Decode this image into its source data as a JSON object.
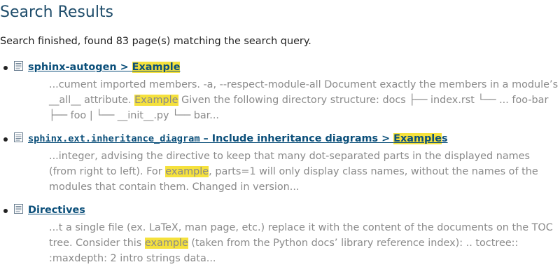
{
  "page": {
    "title": "Search Results",
    "status": "Search finished, found 83 page(s) matching the search query."
  },
  "results": [
    {
      "icon": "document-icon",
      "link": {
        "prefix_code": "",
        "prefix": "sphinx-autogen > ",
        "highlight": "Example",
        "suffix": ""
      },
      "context": {
        "before": "...cument imported members. -a, --respect-module-all Document exactly the members in a module’s __all__ attribute. ",
        "highlight": "Example",
        "after": " Given the following directory structure: docs  ├── index.rst  └── ... foo-bar  ├── foo  |  └── __init__.py  └── bar..."
      }
    },
    {
      "icon": "document-icon",
      "link": {
        "prefix_code": "sphinx.ext.inheritance_diagram",
        "prefix": " – Include inheritance diagrams > ",
        "highlight": "Example",
        "suffix": "s"
      },
      "context": {
        "before": "...integer, advising the directive to keep that many dot-separated parts in the displayed names (from right to left). For ",
        "highlight": "example",
        "after": ", parts=1 will only display class names, without the names of the modules that contain them. Changed in version..."
      }
    },
    {
      "icon": "document-icon",
      "link": {
        "prefix_code": "",
        "prefix": "Directives",
        "highlight": "",
        "suffix": ""
      },
      "context": {
        "before": "...t a single file (ex. LaTeX, man page, etc.) replace it with the content of the documents on the TOC tree. Consider this ",
        "highlight": "example",
        "after": " (taken from the Python docs’ library reference index): .. toctree:: :maxdepth: 2 intro strings data..."
      }
    }
  ],
  "colors": {
    "title": "#1f4d6b",
    "link": "#0b4f7a",
    "highlight": "#f5e13d",
    "context_text": "#8a8a8a"
  }
}
